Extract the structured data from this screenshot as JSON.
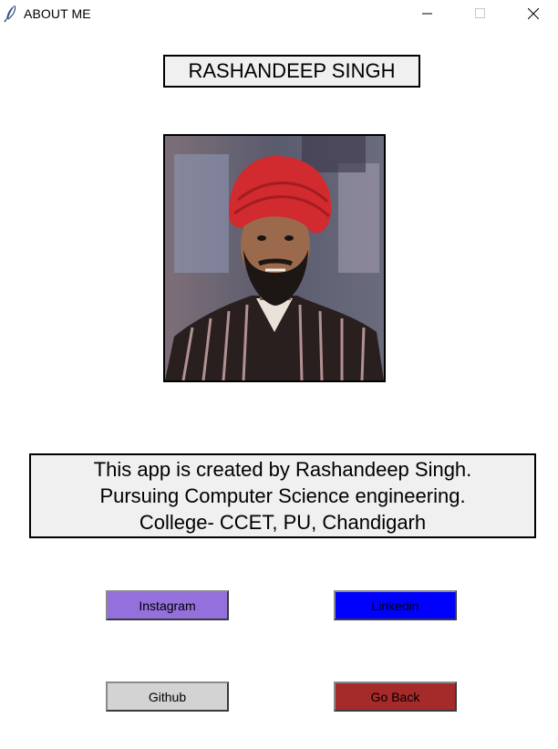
{
  "window": {
    "title": "ABOUT ME",
    "app_icon": "feather-icon",
    "controls": [
      "minimize-icon",
      "maximize-icon",
      "close-icon"
    ]
  },
  "profile": {
    "name": "RASHANDEEP SINGH",
    "photo": "profile-photo"
  },
  "about": {
    "line1": "This app is created by Rashandeep Singh.",
    "line2": "Pursuing Computer Science engineering.",
    "line3": "College- CCET, PU, Chandigarh"
  },
  "buttons": {
    "instagram": {
      "label": "Instagram",
      "bg": "#9370db"
    },
    "linkedin": {
      "label": "Linkedin",
      "bg": "#0000ff"
    },
    "github": {
      "label": "Github",
      "bg": "#d3d3d3"
    },
    "go_back": {
      "label": "Go Back",
      "bg": "#a52a2a"
    }
  }
}
